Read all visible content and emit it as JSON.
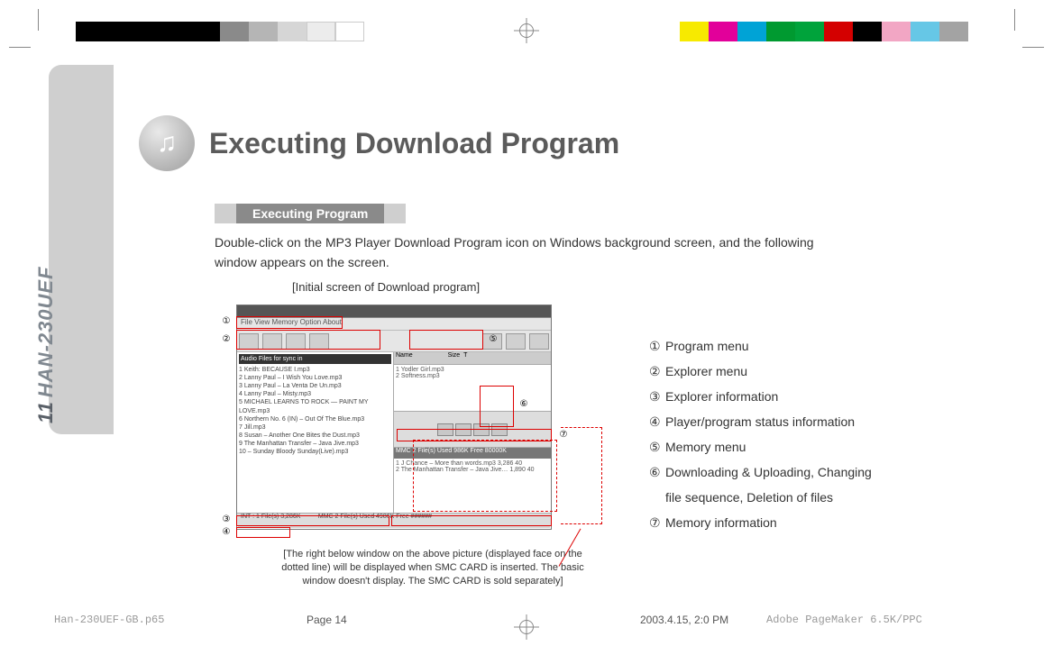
{
  "colorbars": {
    "left": [
      "#000000",
      "#000000",
      "#000000",
      "#000000",
      "#000000",
      "#a0a0a0",
      "#c8c8c8",
      "#e2e2e2",
      "#ffffff",
      "#ffffff"
    ],
    "right": [
      "#f7ea00",
      "#e2009a",
      "#00a3d6",
      "#009a30",
      "#00a33b",
      "#d40000",
      "#000000",
      "#f2a6c4",
      "#66c7e6",
      "#a3a3a3"
    ]
  },
  "side_tab": {
    "page_number": "11",
    "model": "HAN-230UEF"
  },
  "title": "Executing Download Program",
  "section_label": "Executing Program",
  "body": {
    "line1": "Double-click on the MP3 Player Download Program icon on Windows background screen, and the following",
    "line2": "window appears on the screen.",
    "caption": "[Initial screen of Download program]"
  },
  "screenshot": {
    "menu_text": "File  View  Memory  Option  About",
    "list_header": "Audio Files for sync in",
    "list_rows": [
      "1  Keith: BECAUSE I.mp3",
      "2  Lanny Paul – I Wish You Love.mp3",
      "3  Lanny Paul – La Venta De Un.mp3",
      "4  Lanny Paul – Misty.mp3",
      "5  MICHAEL LEARNS TO ROCK — PAINT MY LOVE.mp3",
      "6  Northern No. 6 (IN) – Out Of The Blue.mp3",
      "7  Jill.mp3",
      "8  Susan – Another One Bites the Dust.mp3",
      "9  The Manhattan Transfer – Java Jive.mp3",
      "10 – Sunday Bloody Sunday(Live).mp3"
    ],
    "right_rows": [
      "1 Yodler Girl.mp3",
      "2 Softness.mp3"
    ],
    "mem_bar": "MMC    2 File(s)  Used 986K  Free 80000K",
    "bottom_rows": [
      "1 J Chance – More than words.mp3   3,286  40",
      "2 The Manhattan Transfer – Java Jive…  1,890  40"
    ],
    "status_left": "INT : 1 File(s)   3,286K",
    "status_right": "MMC   2 File(s)  Used 4986K  Free ######"
  },
  "note": "[The right below window on the above picture (displayed face on the dotted line) will be displayed when SMC CARD is inserted. The basic window doesn't display. The SMC CARD is sold separately]",
  "legend": [
    {
      "num": "①",
      "text": "Program menu"
    },
    {
      "num": "②",
      "text": "Explorer menu"
    },
    {
      "num": "③",
      "text": "Explorer information"
    },
    {
      "num": "④",
      "text": "Player/program status information"
    },
    {
      "num": "⑤",
      "text": "Memory menu"
    },
    {
      "num": "⑥",
      "text": "Downloading & Uploading, Changing"
    },
    {
      "num": "",
      "text": "file sequence, Deletion of files"
    },
    {
      "num": "⑦",
      "text": "Memory information"
    }
  ],
  "callouts": {
    "c1": "①",
    "c2": "②",
    "c3": "③",
    "c4": "④",
    "c5": "⑤",
    "c6": "⑥",
    "c7": "⑦"
  },
  "footer": {
    "filename": "Han-230UEF-GB.p65",
    "page": "Page 14",
    "date": "2003.4.15, 2:0 PM",
    "app": "Adobe PageMaker 6.5K/PPC"
  }
}
